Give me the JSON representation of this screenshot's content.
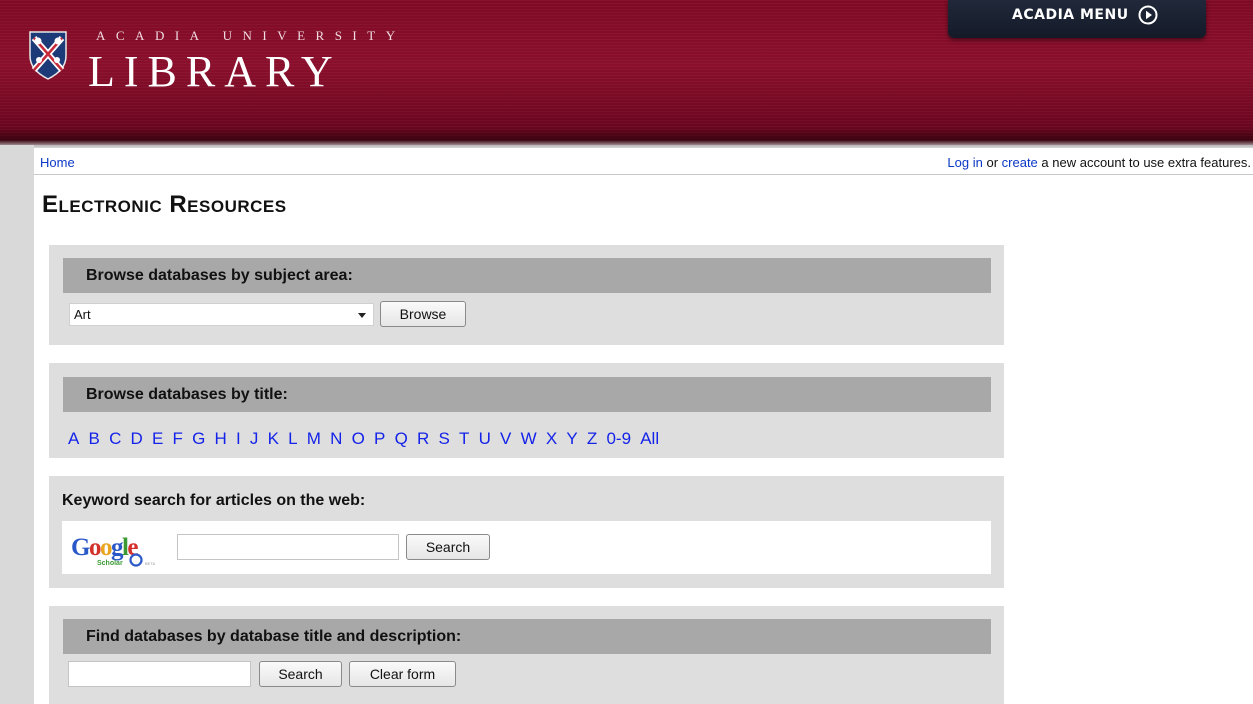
{
  "header": {
    "brand_small": "ACADIA UNIVERSITY",
    "brand_big": "LIBRARY",
    "menu_label": "ACADIA MENU"
  },
  "nav": {
    "home": "Home",
    "login": "Log in",
    "or": "or",
    "create": "create",
    "suffix": "a new account to use extra features."
  },
  "page_title": "Electronic Resources",
  "subject_panel": {
    "heading": "Browse databases by subject area:",
    "selected": "Art",
    "button": "Browse"
  },
  "title_panel": {
    "heading": "Browse databases by title:",
    "letters": [
      "A",
      "B",
      "C",
      "D",
      "E",
      "F",
      "G",
      "H",
      "I",
      "J",
      "K",
      "L",
      "M",
      "N",
      "O",
      "P",
      "Q",
      "R",
      "S",
      "T",
      "U",
      "V",
      "W",
      "X",
      "Y",
      "Z",
      "0-9",
      "All"
    ]
  },
  "keyword_panel": {
    "heading": "Keyword search for articles on the web:",
    "logo_text": "Google",
    "logo_sub": "Scholar",
    "logo_beta": "BETA",
    "search_value": "",
    "button": "Search"
  },
  "find_panel": {
    "heading": "Find databases by database title and description:",
    "search_value": "",
    "search_button": "Search",
    "clear_button": "Clear form"
  },
  "colors": {
    "header_red": "#7f0a25",
    "link_blue": "#0b38c7",
    "letter_blue": "#1423e8",
    "panel_gray": "#dedede",
    "panel_head_gray": "#a8a8a8"
  }
}
